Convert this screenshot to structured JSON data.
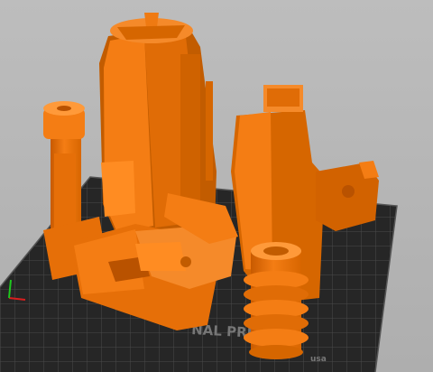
{
  "bed": {
    "brand_text": "NAL PRU",
    "corner_text": "usa"
  },
  "colors": {
    "background": "#b5b5b5",
    "bed_surface": "#2a2a2a",
    "bed_grid": "#4a4a4a",
    "model_main": "#f07a12",
    "model_shadow": "#b95200",
    "model_highlight": "#ff9a3a",
    "axis_x": "#d81e1e",
    "axis_y": "#1ec81e"
  },
  "scene": {
    "objects": [
      "printed-part-tall-column",
      "printed-part-left-pipe",
      "printed-part-right-block",
      "printed-part-front-arm",
      "printed-part-spring-cylinder"
    ]
  }
}
